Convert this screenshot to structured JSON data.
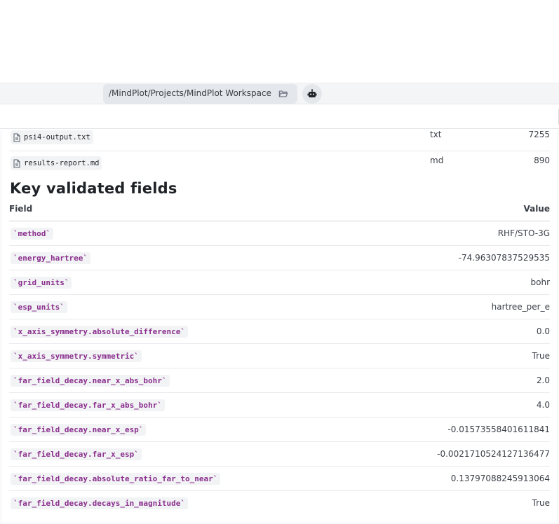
{
  "path_bar": {
    "path": "/MindPlot/Projects/MindPlot Workspace",
    "folder_icon": "folder-open-icon",
    "assistant_icon": "robot-icon"
  },
  "files": [
    {
      "name": "psi4-output.txt",
      "ext": "txt",
      "size": "7255",
      "icon": "file-icon"
    },
    {
      "name": "results-report.md",
      "ext": "md",
      "size": "890",
      "icon": "file-icon"
    }
  ],
  "section": {
    "title": "Key validated fields",
    "col_field": "Field",
    "col_value": "Value"
  },
  "fields": [
    {
      "key": "`method`",
      "value": "RHF/STO-3G"
    },
    {
      "key": "`energy_hartree`",
      "value": "-74.96307837529535"
    },
    {
      "key": "`grid_units`",
      "value": "bohr"
    },
    {
      "key": "`esp_units`",
      "value": "hartree_per_e"
    },
    {
      "key": "`x_axis_symmetry.absolute_difference`",
      "value": "0.0"
    },
    {
      "key": "`x_axis_symmetry.symmetric`",
      "value": "True"
    },
    {
      "key": "`far_field_decay.near_x_abs_bohr`",
      "value": "2.0"
    },
    {
      "key": "`far_field_decay.far_x_abs_bohr`",
      "value": "4.0"
    },
    {
      "key": "`far_field_decay.near_x_esp`",
      "value": "-0.01573558401611841"
    },
    {
      "key": "`far_field_decay.far_x_esp`",
      "value": "-0.0021710524127136477"
    },
    {
      "key": "`far_field_decay.absolute_ratio_far_to_near`",
      "value": "0.13797088245913064"
    },
    {
      "key": "`far_field_decay.decays_in_magnitude`",
      "value": "True"
    }
  ]
}
